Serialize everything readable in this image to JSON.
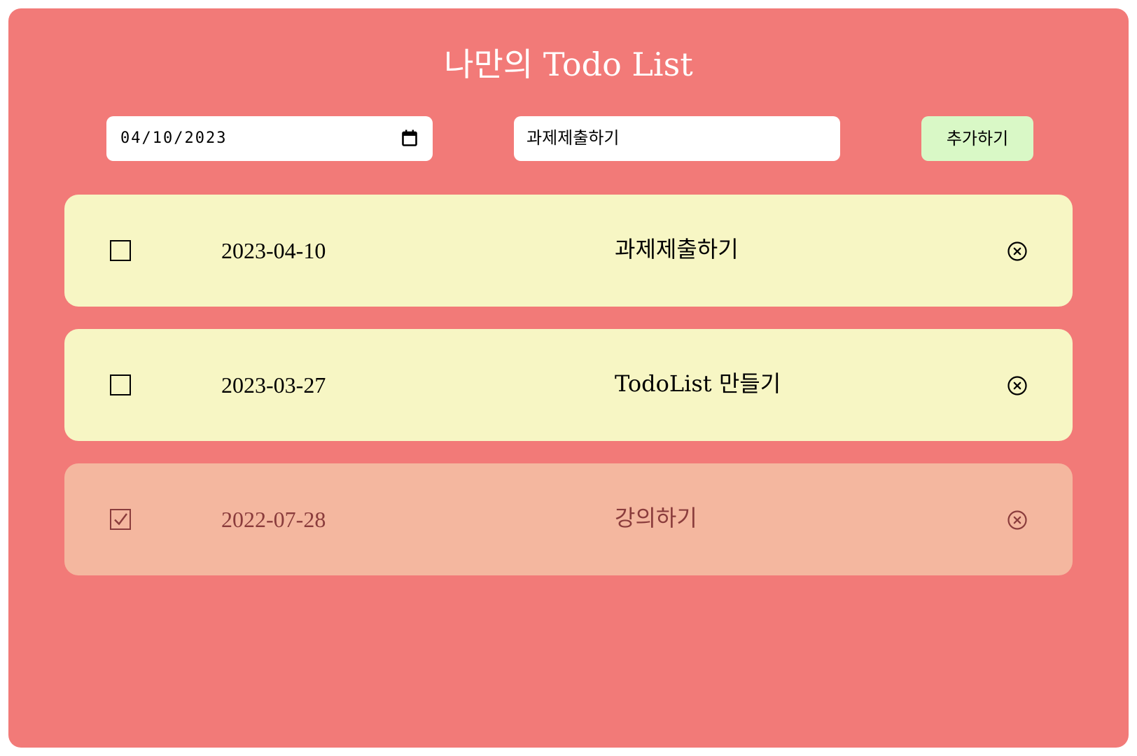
{
  "colors": {
    "background": "#f27a78",
    "title_text": "#ffffff",
    "input_background": "#ffffff",
    "add_button": "#d9f8c6",
    "todo_active_bg": "#f7f6c4",
    "todo_active_text": "#000000",
    "todo_done_bg": "#f4b79f",
    "todo_done_text": "#8a3c3c"
  },
  "header": {
    "title": "나만의 Todo List"
  },
  "form": {
    "date_value": "04/10/2023",
    "calendar_icon": "calendar-icon",
    "text_value": "과제제출하기",
    "add_button_label": "추가하기"
  },
  "todos": [
    {
      "date": "2023-04-10",
      "text": "과제제출하기",
      "completed": false
    },
    {
      "date": "2023-03-27",
      "text": "TodoList 만들기",
      "completed": false
    },
    {
      "date": "2022-07-28",
      "text": "강의하기",
      "completed": true
    }
  ]
}
